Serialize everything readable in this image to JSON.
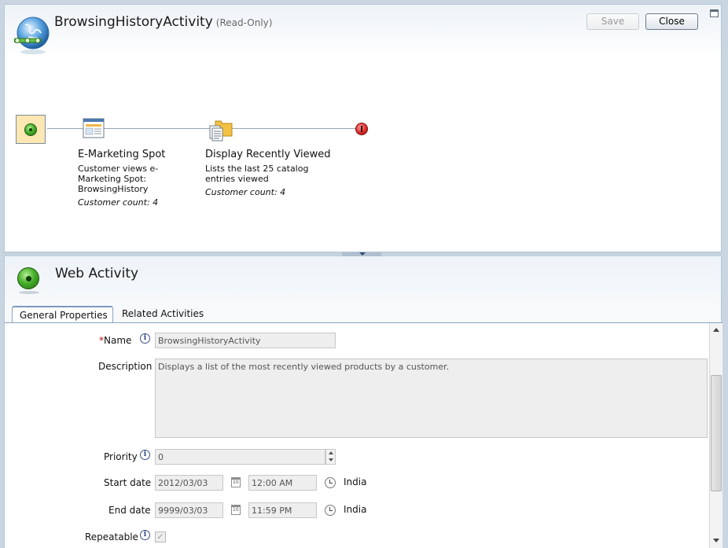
{
  "header": {
    "title": "BrowsingHistoryActivity",
    "status": "(Read-Only)",
    "save_label": "Save",
    "close_label": "Close"
  },
  "flow": {
    "nodes": [
      {
        "title": "E-Marketing Spot",
        "description": "Customer views e-Marketing Spot: BrowsingHistory",
        "count": "Customer count: 4",
        "icon": "e-marketing-spot-icon"
      },
      {
        "title": "Display Recently Viewed",
        "description": "Lists the last 25 catalog entries viewed",
        "count": "Customer count: 4",
        "icon": "display-recently-viewed-icon"
      }
    ]
  },
  "panel": {
    "title": "Web Activity",
    "tabs": [
      {
        "label": "General Properties",
        "active": true
      },
      {
        "label": "Related Activities",
        "active": false
      }
    ]
  },
  "form": {
    "name": {
      "required_mark": "*",
      "label": "Name",
      "value": "BrowsingHistoryActivity"
    },
    "description": {
      "label": "Description",
      "value": "Displays a list of the most recently viewed products by a customer."
    },
    "priority": {
      "label": "Priority",
      "value": "0"
    },
    "start": {
      "label": "Start date",
      "date": "2012/03/03",
      "time": "12:00 AM",
      "timezone": "India"
    },
    "end": {
      "label": "End date",
      "date": "9999/03/03",
      "time": "11:59 PM",
      "timezone": "India"
    },
    "repeatable": {
      "label": "Repeatable",
      "checked": true,
      "check_glyph": "✓"
    },
    "info_glyph": "i"
  },
  "colors": {
    "start_node_fill": "#fde7b2",
    "tab_border": "#8aa5bf",
    "required": "#cc0000"
  }
}
